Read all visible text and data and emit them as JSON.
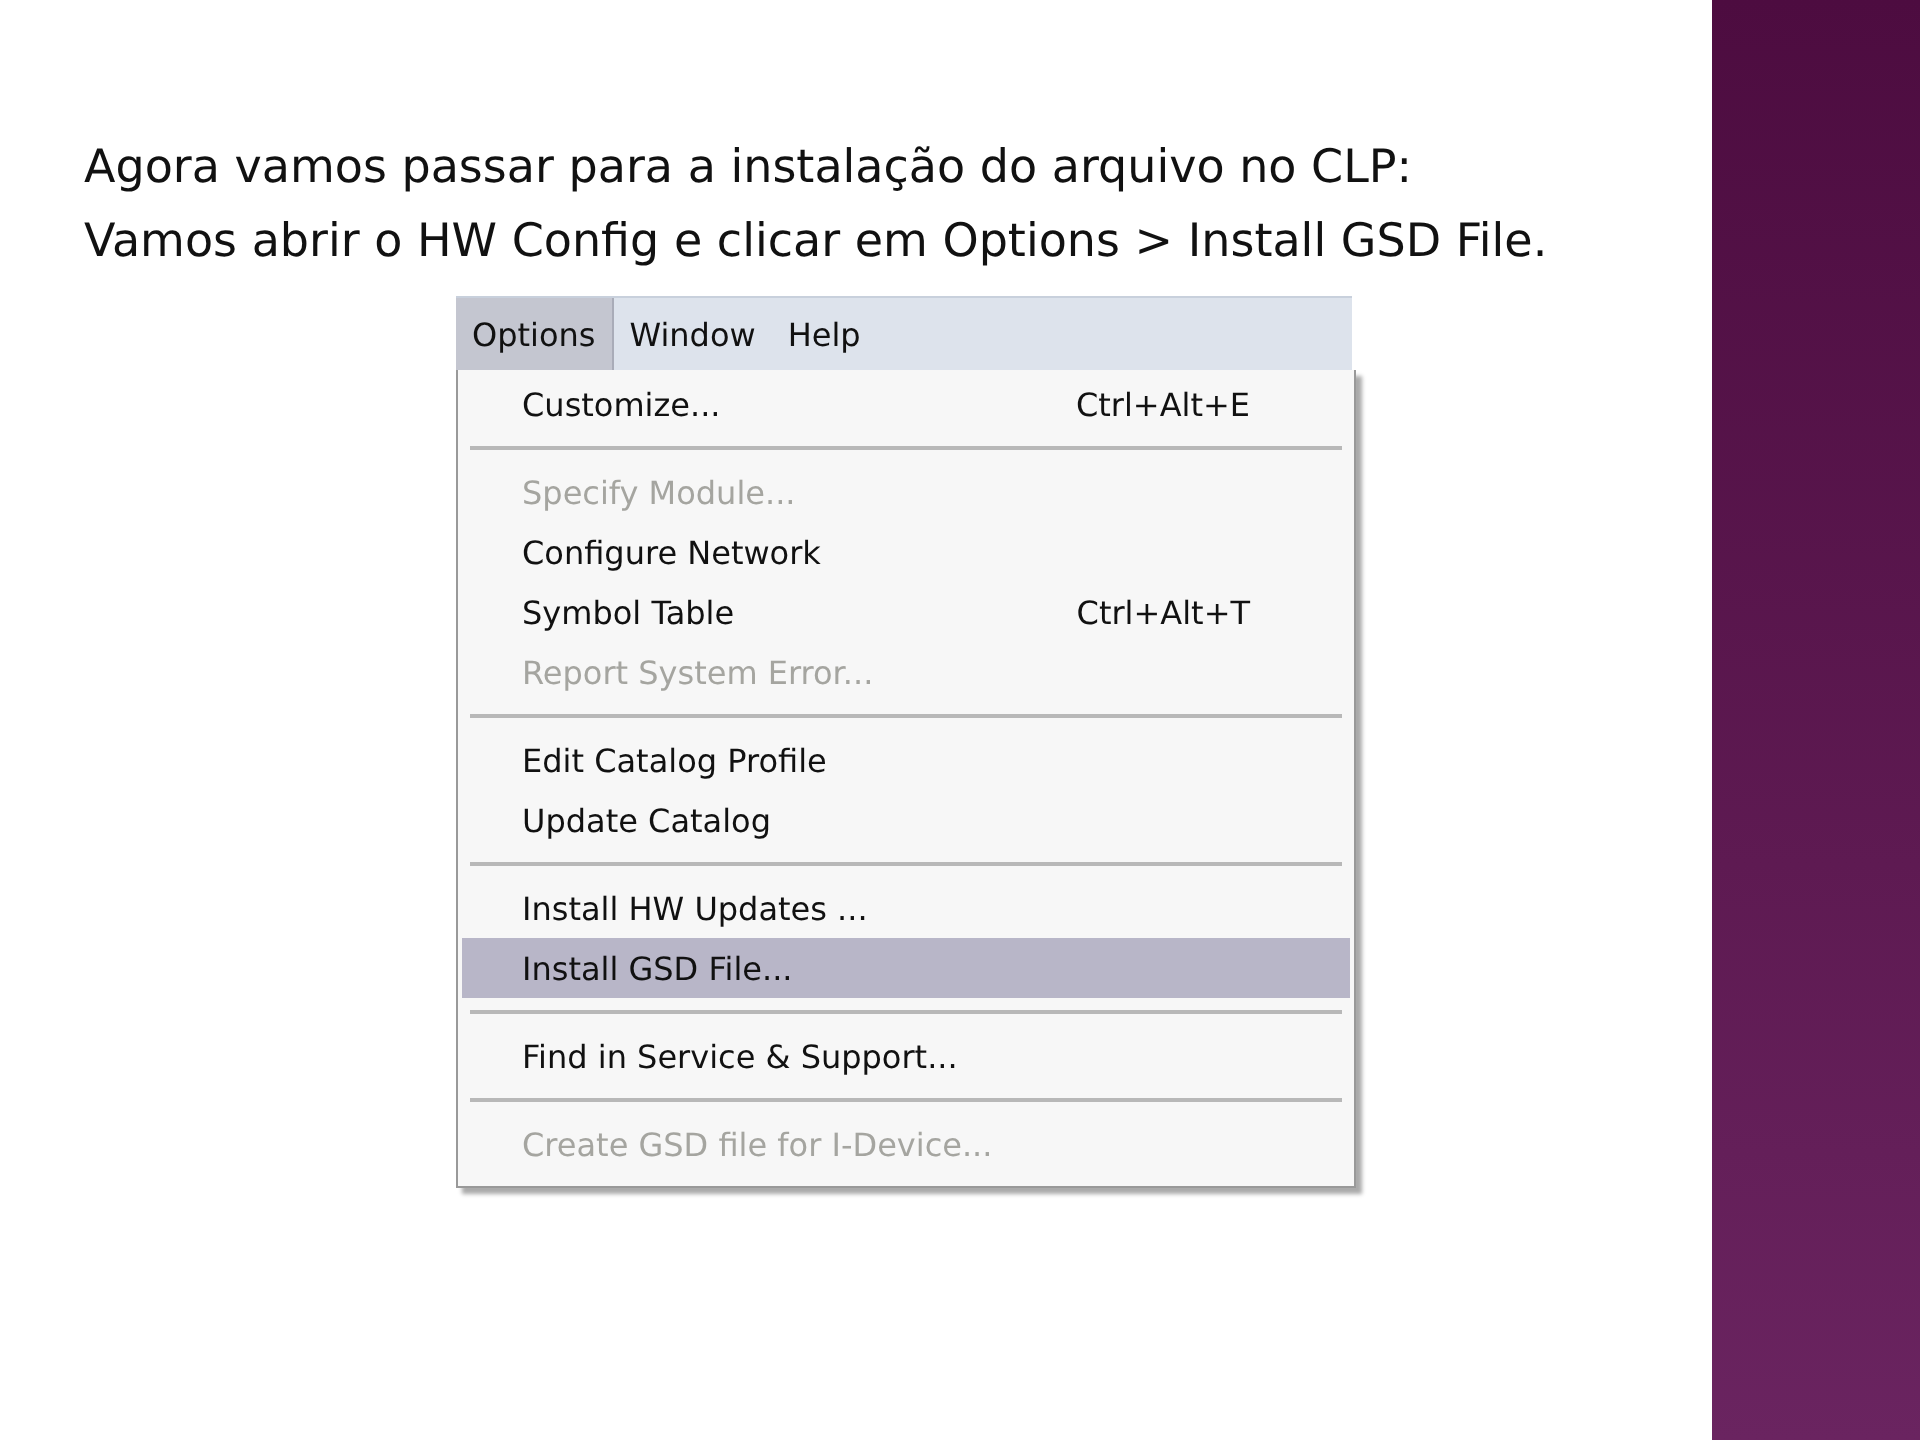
{
  "paragraphs": [
    "Agora vamos passar para a instalação do arquivo no CLP:",
    "Vamos abrir o HW  Config e clicar em Options > Install GSD File."
  ],
  "menu_bar": [
    {
      "label": "Options",
      "selected": true
    },
    {
      "label": "Window",
      "selected": false
    },
    {
      "label": "Help",
      "selected": false
    }
  ],
  "menu_items": [
    {
      "kind": "item",
      "label": "Customize...",
      "shortcut": "Ctrl+Alt+E",
      "disabled": false,
      "selected": false
    },
    {
      "kind": "separator"
    },
    {
      "kind": "item",
      "label": "Specify Module...",
      "disabled": true,
      "selected": false
    },
    {
      "kind": "item",
      "label": "Configure Network",
      "disabled": false,
      "selected": false
    },
    {
      "kind": "item",
      "label": "Symbol Table",
      "shortcut": "Ctrl+Alt+T",
      "disabled": false,
      "selected": false
    },
    {
      "kind": "item",
      "label": "Report System Error...",
      "disabled": true,
      "selected": false
    },
    {
      "kind": "separator"
    },
    {
      "kind": "item",
      "label": "Edit Catalog Profile",
      "disabled": false,
      "selected": false
    },
    {
      "kind": "item",
      "label": "Update Catalog",
      "disabled": false,
      "selected": false
    },
    {
      "kind": "separator"
    },
    {
      "kind": "item",
      "label": "Install HW Updates ...",
      "disabled": false,
      "selected": false
    },
    {
      "kind": "item",
      "label": "Install GSD File...",
      "disabled": false,
      "selected": true
    },
    {
      "kind": "separator"
    },
    {
      "kind": "item",
      "label": "Find in Service & Support...",
      "disabled": false,
      "selected": false
    },
    {
      "kind": "separator"
    },
    {
      "kind": "item",
      "label": "Create GSD file for I-Device...",
      "disabled": true,
      "selected": false
    }
  ]
}
